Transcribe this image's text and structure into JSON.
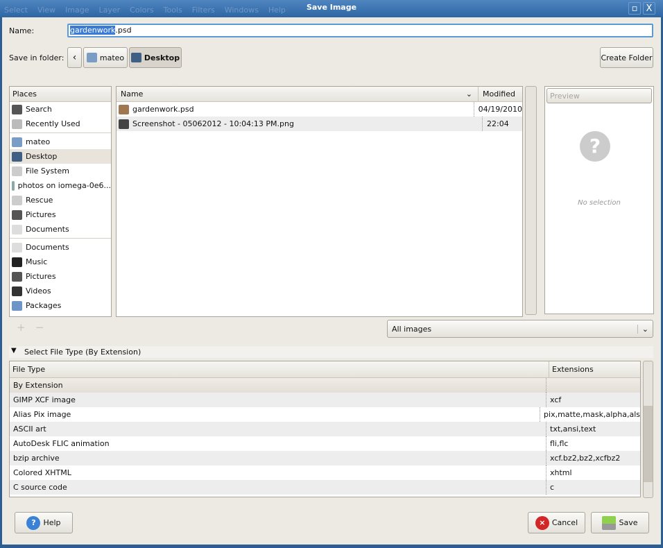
{
  "window": {
    "title": "Save Image",
    "bg_menu": [
      "Select",
      "View",
      "Image",
      "Layer",
      "Colors",
      "Tools",
      "Filters",
      "Windows",
      "Help"
    ],
    "maximize": "▫",
    "close": "X"
  },
  "name": {
    "label": "Name:",
    "value_selected": "gardenwork",
    "value_rest": ".psd"
  },
  "folder": {
    "label": "Save in folder:",
    "back": "‹",
    "crumbs": [
      "mateo",
      "Desktop"
    ],
    "create_folder": "Create Folder"
  },
  "places": {
    "header": "Places",
    "groups": [
      [
        {
          "label": "Search",
          "icon": "search-icon"
        },
        {
          "label": "Recently Used",
          "icon": "clock-icon"
        }
      ],
      [
        {
          "label": "mateo",
          "icon": "home-folder-icon"
        },
        {
          "label": "Desktop",
          "icon": "desktop-icon",
          "selected": true
        },
        {
          "label": "File System",
          "icon": "drive-icon"
        },
        {
          "label": "photos on iomega-0e6...",
          "icon": "network-folder-icon"
        },
        {
          "label": "Rescue",
          "icon": "drive-icon"
        },
        {
          "label": "Pictures",
          "icon": "pictures-icon"
        },
        {
          "label": "Documents",
          "icon": "documents-icon"
        }
      ],
      [
        {
          "label": "Documents",
          "icon": "documents-icon"
        },
        {
          "label": "Music",
          "icon": "music-icon"
        },
        {
          "label": "Pictures",
          "icon": "pictures-icon"
        },
        {
          "label": "Videos",
          "icon": "videos-icon"
        },
        {
          "label": "Packages",
          "icon": "folder-icon"
        }
      ]
    ],
    "add": "+",
    "remove": "−"
  },
  "files": {
    "columns": [
      "Name",
      "Modified"
    ],
    "rows": [
      {
        "name": "gardenwork.psd",
        "modified": "04/19/2010"
      },
      {
        "name": "Screenshot - 05062012 - 10:04:13 PM.png",
        "modified": "22:04"
      }
    ]
  },
  "preview": {
    "header": "Preview",
    "empty": "No selection"
  },
  "filter": {
    "value": "All images"
  },
  "filetype": {
    "expander": "Select File Type (By Extension)",
    "columns": [
      "File Type",
      "Extensions"
    ],
    "rows": [
      {
        "type": "By Extension",
        "ext": ""
      },
      {
        "type": "GIMP XCF image",
        "ext": "xcf"
      },
      {
        "type": "Alias Pix image",
        "ext": "pix,matte,mask,alpha,als"
      },
      {
        "type": "ASCII art",
        "ext": "txt,ansi,text"
      },
      {
        "type": "AutoDesk FLIC animation",
        "ext": "fli,flc"
      },
      {
        "type": "bzip archive",
        "ext": "xcf.bz2,bz2,xcfbz2"
      },
      {
        "type": "Colored XHTML",
        "ext": "xhtml"
      },
      {
        "type": "C source code",
        "ext": "c"
      }
    ]
  },
  "buttons": {
    "help": "Help",
    "cancel": "Cancel",
    "save": "Save"
  },
  "colors": {
    "titlebar": "#2e66a4",
    "selection": "#3a7bd5"
  }
}
